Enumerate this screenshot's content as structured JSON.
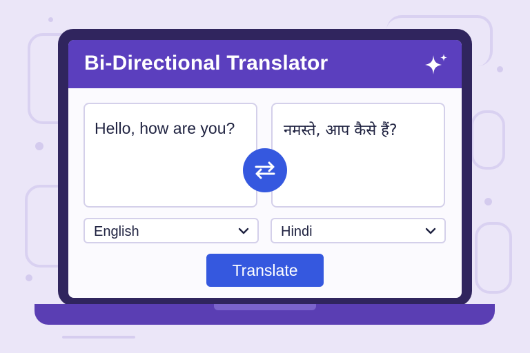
{
  "app": {
    "title": "Bi-Directional Translator"
  },
  "source": {
    "text": "Hello, how are you?",
    "language": "English"
  },
  "target": {
    "text": "नमस्ते, आप कैसे हैं?",
    "language": "Hindi"
  },
  "actions": {
    "translate_label": "Translate",
    "swap_icon": "swap-arrows-icon"
  },
  "colors": {
    "header": "#5b3fbe",
    "accent": "#3558df",
    "bezel": "#30255e",
    "background": "#ebe6f8"
  }
}
